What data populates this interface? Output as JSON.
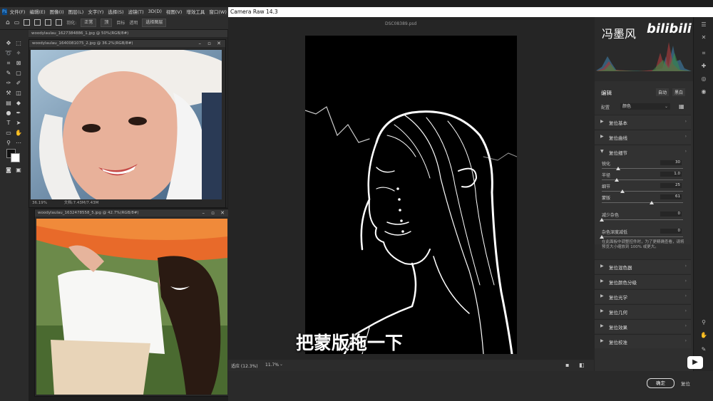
{
  "ps": {
    "logo": "Ps",
    "menu": [
      "文件(F)",
      "编辑(E)",
      "图像(I)",
      "图层(L)",
      "文字(Y)",
      "选择(S)",
      "滤镜(T)",
      "3D(D)",
      "视图(V)",
      "增效工具",
      "窗口(W)",
      "帮助"
    ],
    "options": {
      "feather": "羽化:",
      "mode": "正常",
      "btn1": "顶",
      "btn2": "目标",
      "btn3": "透明",
      "btn4": "选择图层"
    }
  },
  "doc1": {
    "tab": "woodylaulau_1627384886_1.jpg @ 50%(RGB/8#)",
    "inner_tab": "woodylaulau_1640081075_2.jpg @ 36.2%(RGB/8#)",
    "zoom": "36.19%",
    "doc_info": "文档:7.43M/7.43M"
  },
  "doc2": {
    "tab": "woodylaulau_1632478558_5.jpg @ 42.7%(RGB/8#)"
  },
  "cr": {
    "title": "Camera Raw 14.3",
    "filename": "DSC08389.psd",
    "watermark": "冯墨风",
    "watermark_brand": "bilibili",
    "subtitle": "把蒙版拖一下",
    "zoom_label": "适应 (12.3%)",
    "zoom_value": "11.7%",
    "edit_title": "编辑",
    "auto": "自动",
    "bw": "黑白",
    "profile_label": "配置",
    "profile_value": "颜色",
    "sections_top": [
      "复位基本",
      "复位曲线"
    ],
    "detail_section": "复位细节",
    "sliders": [
      {
        "label": "锐化",
        "value": "30",
        "pos": 0.2
      },
      {
        "label": "半径",
        "value": "1.0",
        "pos": 0.18
      },
      {
        "label": "细节",
        "value": "25",
        "pos": 0.25
      },
      {
        "label": "蒙版",
        "value": "61",
        "pos": 0.61
      }
    ],
    "noise_sliders": [
      {
        "label": "减少杂色",
        "value": "0",
        "pos": 0.0
      },
      {
        "label": "杂色深度减低",
        "value": "0",
        "pos": 0.0
      }
    ],
    "hint": "在此面板中调整控件时，为了更精确查看，请将预览大小缩放到 100% 或更大。",
    "sections_bottom": [
      "复位混色器",
      "复位颜色分级",
      "复位光学",
      "复位几何",
      "复位效果",
      "复位校准"
    ],
    "ok": "确定",
    "reset": "复位"
  }
}
